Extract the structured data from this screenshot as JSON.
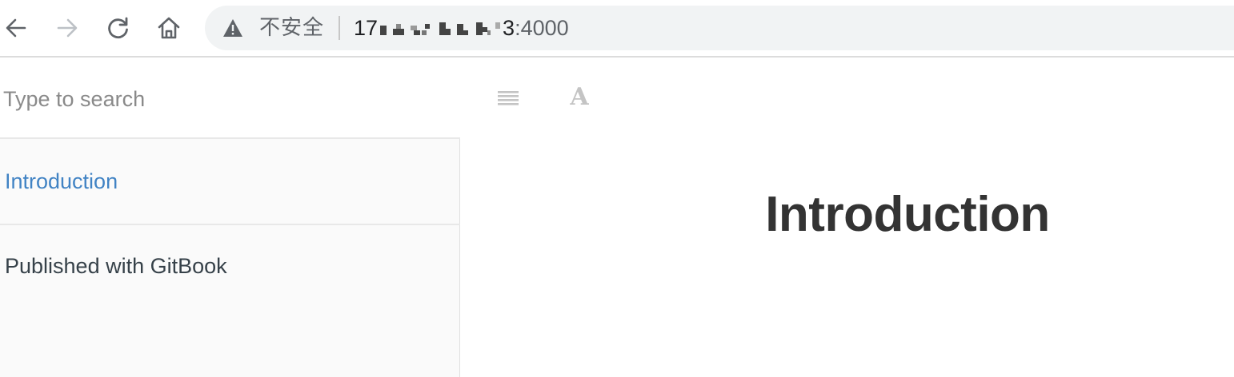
{
  "browser": {
    "security_label": "不安全",
    "url_prefix": "17",
    "url_suffix": "3",
    "url_port": ":4000"
  },
  "sidebar": {
    "search_placeholder": "Type to search",
    "items": [
      {
        "label": "Introduction",
        "active": true
      }
    ],
    "footer_link": "Published with GitBook"
  },
  "content": {
    "font_button": "A",
    "title": "Introduction"
  },
  "colors": {
    "link": "#4183c4",
    "sidebar_bg": "#fafafa",
    "omnibox_bg": "#f1f3f4"
  }
}
